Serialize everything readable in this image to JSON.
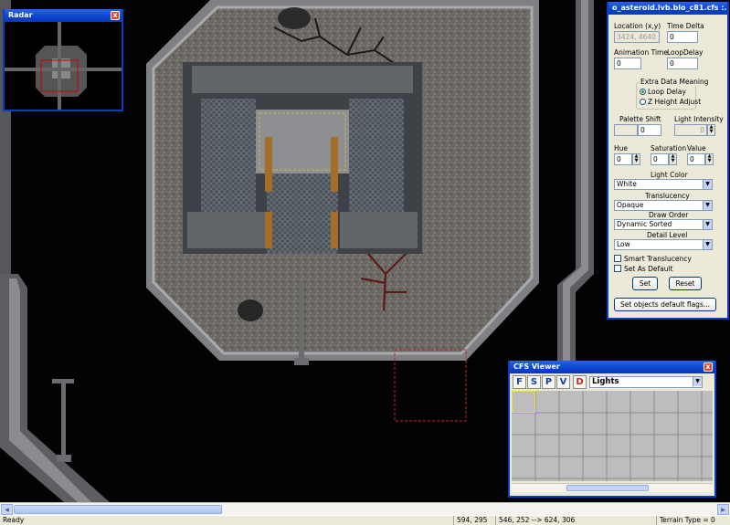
{
  "properties": {
    "title": "o_asteroid.lvb.blo_c81.cfs :...",
    "location_label": "Location (x,y)",
    "location_value": "3424, 4640",
    "time_delta_label": "Time Delta",
    "time_delta_value": "0",
    "animation_time_label": "Animation Time",
    "animation_time_value": "0",
    "loop_delay_label": "LoopDelay",
    "loop_delay_value": "0",
    "extra_data_label": "Extra Data Meaning",
    "radio_loop_delay": "Loop Delay",
    "radio_z_height": "Z Height Adjust",
    "palette_shift_label": "Palette Shift",
    "palette_shift_value": "0",
    "light_intensity_label": "Light Intensity",
    "light_intensity_value": "0",
    "hue_label": "Hue",
    "hue_value": "0",
    "saturation_label": "Saturation",
    "saturation_value": "0",
    "value_label": "Value",
    "value_value": "0",
    "light_color_label": "Light Color",
    "light_color_value": "White",
    "translucency_label": "Translucency",
    "translucency_value": "Opaque",
    "draw_order_label": "Draw Order",
    "draw_order_value": "Dynamic Sorted",
    "detail_level_label": "Detail Level",
    "detail_level_value": "Low",
    "smart_translucency": "Smart Translucency",
    "set_as_default": "Set As Default",
    "set_button": "Set",
    "reset_button": "Reset",
    "default_flags_button": "Set objects default flags..."
  },
  "radar": {
    "title": "Radar",
    "close": "x"
  },
  "cfs_viewer": {
    "title": "CFS Viewer",
    "close": "x",
    "tools": [
      "F",
      "S",
      "P",
      "V",
      "D"
    ],
    "category_value": "Lights"
  },
  "status": {
    "ready": "Ready",
    "coords": "594, 295",
    "range": "546, 252 --> 624, 306",
    "terrain": "Terrain Type = 0"
  },
  "colors": {
    "titlebar": "#0a44d0",
    "panel": "#ece9d8",
    "selection": "#cc2222"
  }
}
